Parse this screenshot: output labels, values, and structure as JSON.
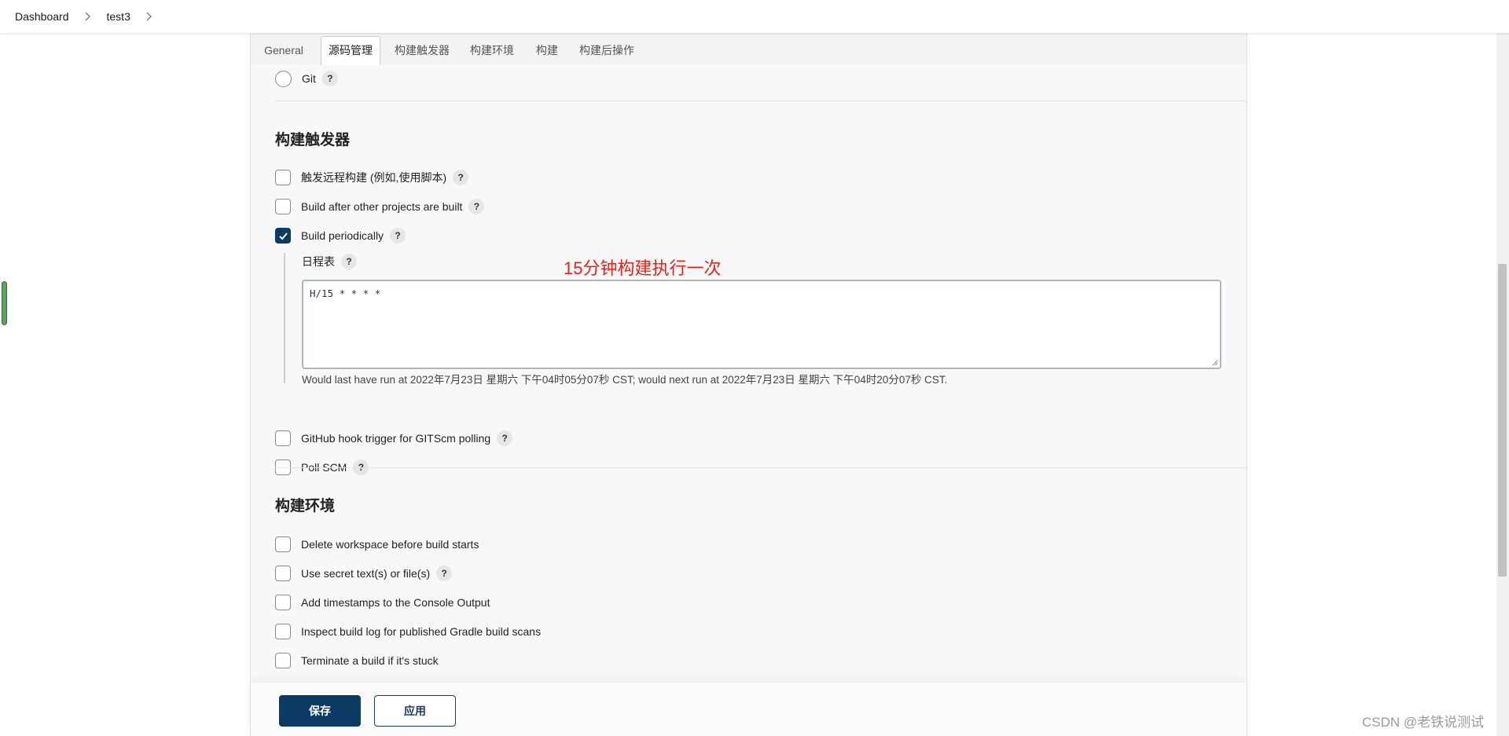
{
  "breadcrumb": {
    "items": [
      "Dashboard",
      "test3"
    ]
  },
  "tabs": [
    "General",
    "源码管理",
    "构建触发器",
    "构建环境",
    "构建",
    "构建后操作"
  ],
  "active_tab": "源码管理",
  "scm": {
    "git_label": "Git"
  },
  "triggers": {
    "title": "构建触发器",
    "remote_build": "触发远程构建 (例如,使用脚本)",
    "after_other": "Build after other projects are built",
    "periodically": "Build periodically",
    "schedule_label": "日程表",
    "schedule_value": "H/15 * * * *",
    "schedule_hint": "Would last have run at 2022年7月23日 星期六 下午04时05分07秒 CST; would next run at 2022年7月23日 星期六 下午04时20分07秒 CST.",
    "github_hook": "GitHub hook trigger for GITScm polling",
    "poll_scm": "Poll SCM",
    "periodically_checked": true
  },
  "annotation": "15分钟构建执行一次",
  "environment": {
    "title": "构建环境",
    "delete_workspace": "Delete workspace before build starts",
    "secret_text": "Use secret text(s) or file(s)",
    "timestamps": "Add timestamps to the Console Output",
    "gradle_scans": "Inspect build log for published Gradle build scans",
    "terminate_stuck": "Terminate a build if it's stuck"
  },
  "buttons": {
    "save": "保存",
    "apply": "应用"
  },
  "help_glyph": "?",
  "watermark": "CSDN @老铁说测试",
  "colors": {
    "primary": "#0b3a63",
    "annotation": "#e8231a"
  }
}
